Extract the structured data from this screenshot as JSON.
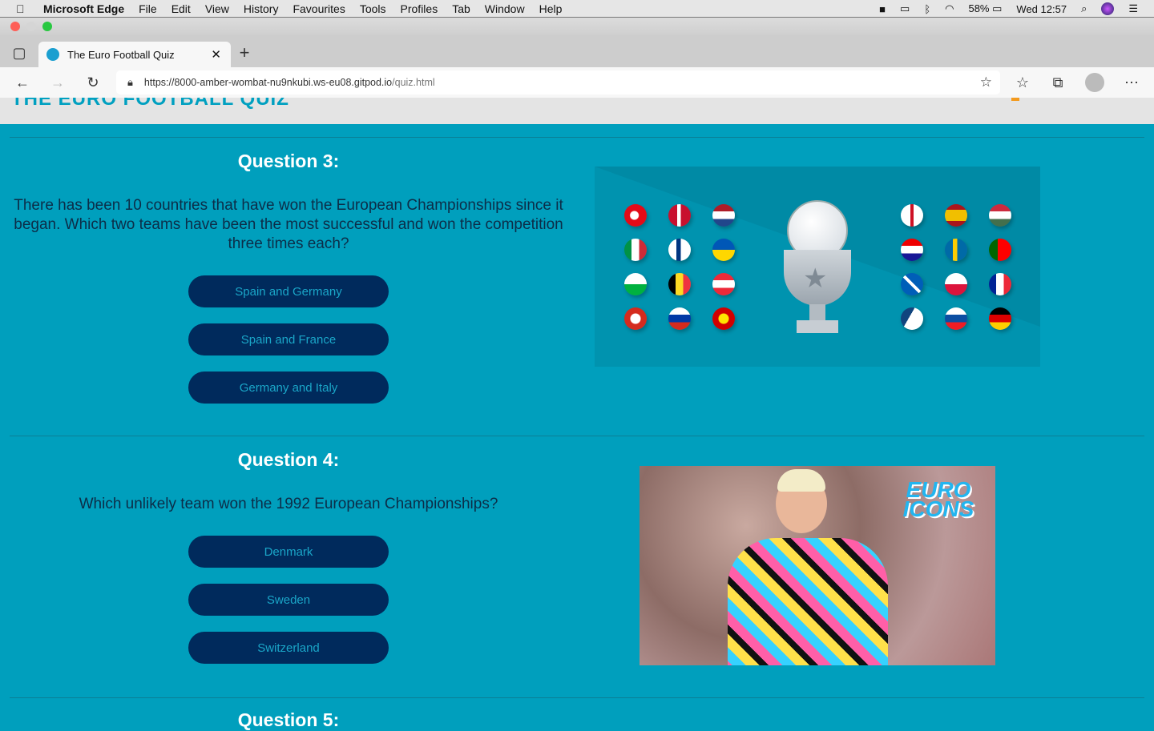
{
  "menubar": {
    "app": "Microsoft Edge",
    "items": [
      "File",
      "Edit",
      "View",
      "History",
      "Favourites",
      "Tools",
      "Profiles",
      "Tab",
      "Window",
      "Help"
    ],
    "battery": "58%",
    "clock": "Wed 12:57"
  },
  "browser": {
    "tab_title": "The Euro Football Quiz",
    "url_main": "https://8000-amber-wombat-nu9nkubi.ws-eu08.gitpod.io",
    "url_path": "/quiz.html"
  },
  "site": {
    "logo": "THE EURO FOOTBALL QUIZ"
  },
  "questions": [
    {
      "title": "Question 3:",
      "text": "There has been 10 countries that have won the European Championships since it began. Which two teams have been the most successful and won the competition three times each?",
      "answers": [
        "Spain and Germany",
        "Spain and France",
        "Germany and Italy"
      ]
    },
    {
      "title": "Question 4:",
      "text": "Which unlikely team won the 1992 European Championships?",
      "answers": [
        "Denmark",
        "Sweden",
        "Switzerland"
      ],
      "image_text": "EURO ICONS"
    },
    {
      "title": "Question 5:"
    }
  ],
  "colors": {
    "bg": "#009fbd",
    "button": "#002a5c",
    "button_text": "#1aa6c8"
  }
}
